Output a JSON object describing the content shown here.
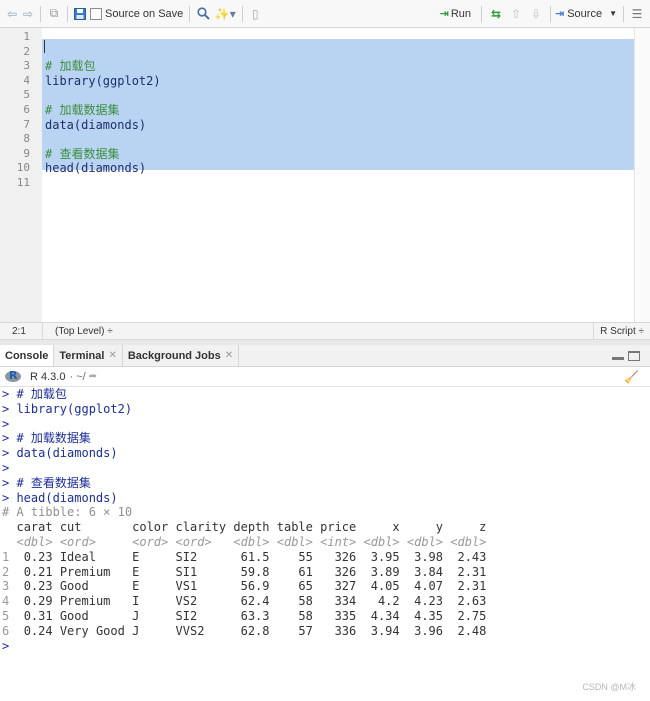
{
  "toolbar": {
    "source_on_save": "Source on Save",
    "run": "Run",
    "source": "Source"
  },
  "editor": {
    "lines": [
      "",
      "",
      "# 加载包",
      "library(ggplot2)",
      "",
      "# 加载数据集",
      "data(diamonds)",
      "",
      "# 查看数据集",
      "head(diamonds)",
      ""
    ],
    "line_numbers": [
      "1",
      "2",
      "3",
      "4",
      "5",
      "6",
      "7",
      "8",
      "9",
      "10",
      "11"
    ]
  },
  "status": {
    "position": "2:1",
    "scope": "(Top Level) ÷",
    "file_type": "R Script ÷"
  },
  "tabs": [
    {
      "label": "Console"
    },
    {
      "label": "Terminal"
    },
    {
      "label": "Background Jobs"
    }
  ],
  "console_header": {
    "version": "R 4.3.0",
    "dir": "· ~/"
  },
  "console": {
    "commands": [
      {
        "prompt": ">",
        "text": " # 加载包"
      },
      {
        "prompt": ">",
        "text": " library(ggplot2)"
      },
      {
        "prompt": ">",
        "text": ""
      },
      {
        "prompt": ">",
        "text": " # 加载数据集"
      },
      {
        "prompt": ">",
        "text": " data(diamonds)"
      },
      {
        "prompt": ">",
        "text": ""
      },
      {
        "prompt": ">",
        "text": " # 查看数据集"
      },
      {
        "prompt": ">",
        "text": " head(diamonds)"
      }
    ],
    "tibble_meta": "# A tibble: 6 × 10",
    "table": {
      "headers": [
        "carat",
        "cut",
        "color",
        "clarity",
        "depth",
        "table",
        "price",
        "x",
        "y",
        "z"
      ],
      "types": [
        "<dbl>",
        "<ord>",
        "<ord>",
        "<ord>",
        "<dbl>",
        "<dbl>",
        "<int>",
        "<dbl>",
        "<dbl>",
        "<dbl>"
      ],
      "rows": [
        [
          "1",
          "0.23",
          "Ideal",
          "E",
          "SI2",
          "61.5",
          "55",
          "326",
          "3.95",
          "3.98",
          "2.43"
        ],
        [
          "2",
          "0.21",
          "Premium",
          "E",
          "SI1",
          "59.8",
          "61",
          "326",
          "3.89",
          "3.84",
          "2.31"
        ],
        [
          "3",
          "0.23",
          "Good",
          "E",
          "VS1",
          "56.9",
          "65",
          "327",
          "4.05",
          "4.07",
          "2.31"
        ],
        [
          "4",
          "0.29",
          "Premium",
          "I",
          "VS2",
          "62.4",
          "58",
          "334",
          "4.2",
          "4.23",
          "2.63"
        ],
        [
          "5",
          "0.31",
          "Good",
          "J",
          "SI2",
          "63.3",
          "58",
          "335",
          "4.34",
          "4.35",
          "2.75"
        ],
        [
          "6",
          "0.24",
          "Very Good",
          "J",
          "VVS2",
          "62.8",
          "57",
          "336",
          "3.94",
          "3.96",
          "2.48"
        ]
      ]
    },
    "final_prompt": ">"
  },
  "watermark": "CSDN @M冰"
}
